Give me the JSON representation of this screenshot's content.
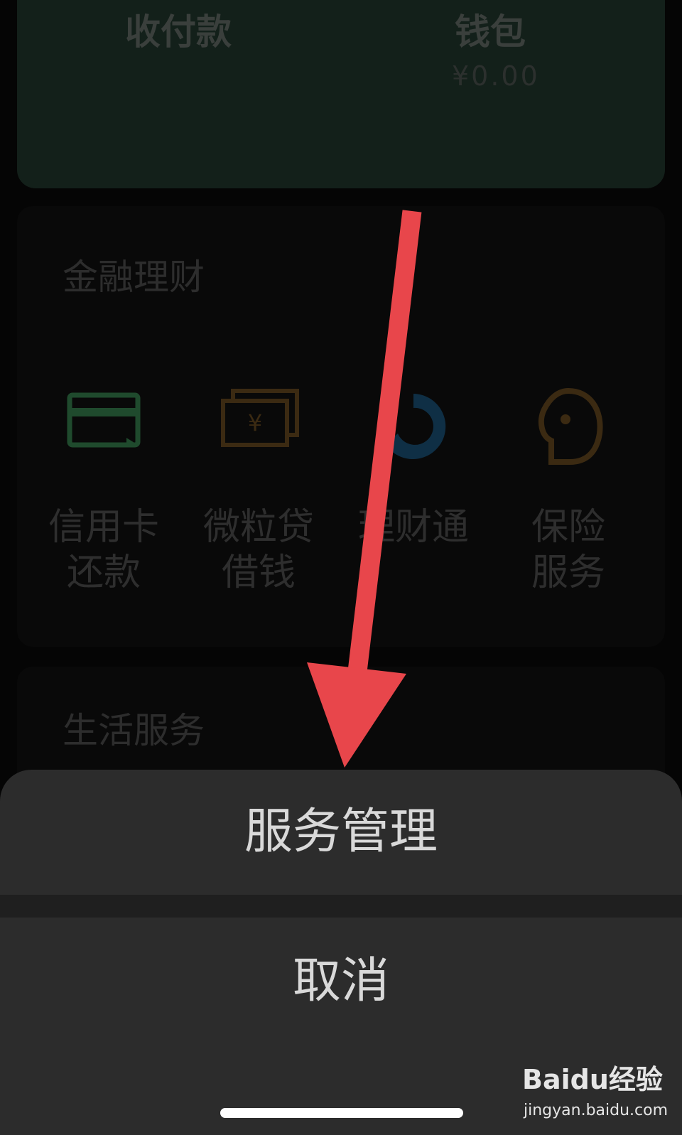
{
  "wallet_card": {
    "receive_pay_label": "收付款",
    "wallet_label": "钱包",
    "wallet_balance": "¥0.00"
  },
  "finance": {
    "title": "金融理财",
    "items": [
      {
        "label_line1": "信用卡",
        "label_line2": "还款",
        "icon": "credit-card-icon",
        "color": "#1f4a2d"
      },
      {
        "label_line1": "微粒贷",
        "label_line2": "借钱",
        "icon": "cash-icon",
        "color": "#3b2a12"
      },
      {
        "label_line1": "理财通",
        "label_line2": "",
        "icon": "licaitong-icon",
        "color": "#0f2f45"
      },
      {
        "label_line1": "保险",
        "label_line2": "服务",
        "icon": "insurance-icon",
        "color": "#3b2a12"
      }
    ]
  },
  "life": {
    "title": "生活服务"
  },
  "action_sheet": {
    "manage_label": "服务管理",
    "cancel_label": "取消"
  },
  "watermark": {
    "logo_text": "Baidu经验",
    "url": "jingyan.baidu.com"
  },
  "colors": {
    "annotation_arrow": "#e8464b",
    "sheet_bg": "#2c2c2c",
    "card_bg": "#13201a"
  }
}
